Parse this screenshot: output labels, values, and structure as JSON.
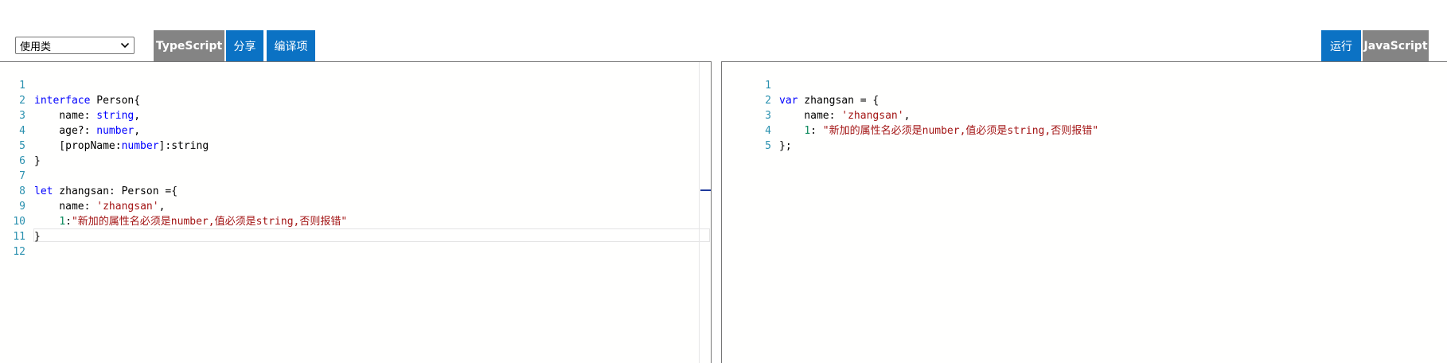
{
  "toolbar": {
    "example_select": "使用类",
    "typescript_label": "TypeScript",
    "share_label": "分享",
    "compile_options_label": "编译项",
    "run_label": "运行",
    "javascript_label": "JavaScript"
  },
  "colors": {
    "button_gray": "#848484",
    "button_blue": "#0b72c4",
    "keyword": "#0000ff",
    "string": "#a31515",
    "number": "#09885a",
    "line_number": "#2b91af"
  },
  "left_editor": {
    "line_numbers": [
      "1",
      "2",
      "3",
      "4",
      "5",
      "6",
      "7",
      "8",
      "9",
      "10",
      "11",
      "12"
    ],
    "l1": {
      "kw": "interface",
      "rest": " Person{"
    },
    "l2": {
      "pre": "    name: ",
      "type": "string",
      "post": ","
    },
    "l3": {
      "pre": "    age?: ",
      "type": "number",
      "post": ","
    },
    "l4": {
      "pre": "    [propName:",
      "type": "number",
      "post": "]:string"
    },
    "l5": "}",
    "l7": {
      "kw": "let",
      "rest": " zhangsan: Person ={"
    },
    "l8": {
      "pre": "    name: ",
      "str": "'zhangsan'",
      "post": ","
    },
    "l9": {
      "pre": "    ",
      "num": "1",
      "colon": ":",
      "str": "\"新加的属性名必须是number,值必须是string,否则报错\""
    },
    "l10": "}"
  },
  "right_editor": {
    "line_numbers": [
      "1",
      "2",
      "3",
      "4",
      "5"
    ],
    "l1": {
      "kw": "var",
      "rest": " zhangsan = {"
    },
    "l2": {
      "pre": "    name: ",
      "str": "'zhangsan'",
      "post": ","
    },
    "l3": {
      "pre": "    ",
      "num": "1",
      "colon": ": ",
      "str": "\"新加的属性名必须是number,值必须是string,否则报错\""
    },
    "l4": "};"
  }
}
